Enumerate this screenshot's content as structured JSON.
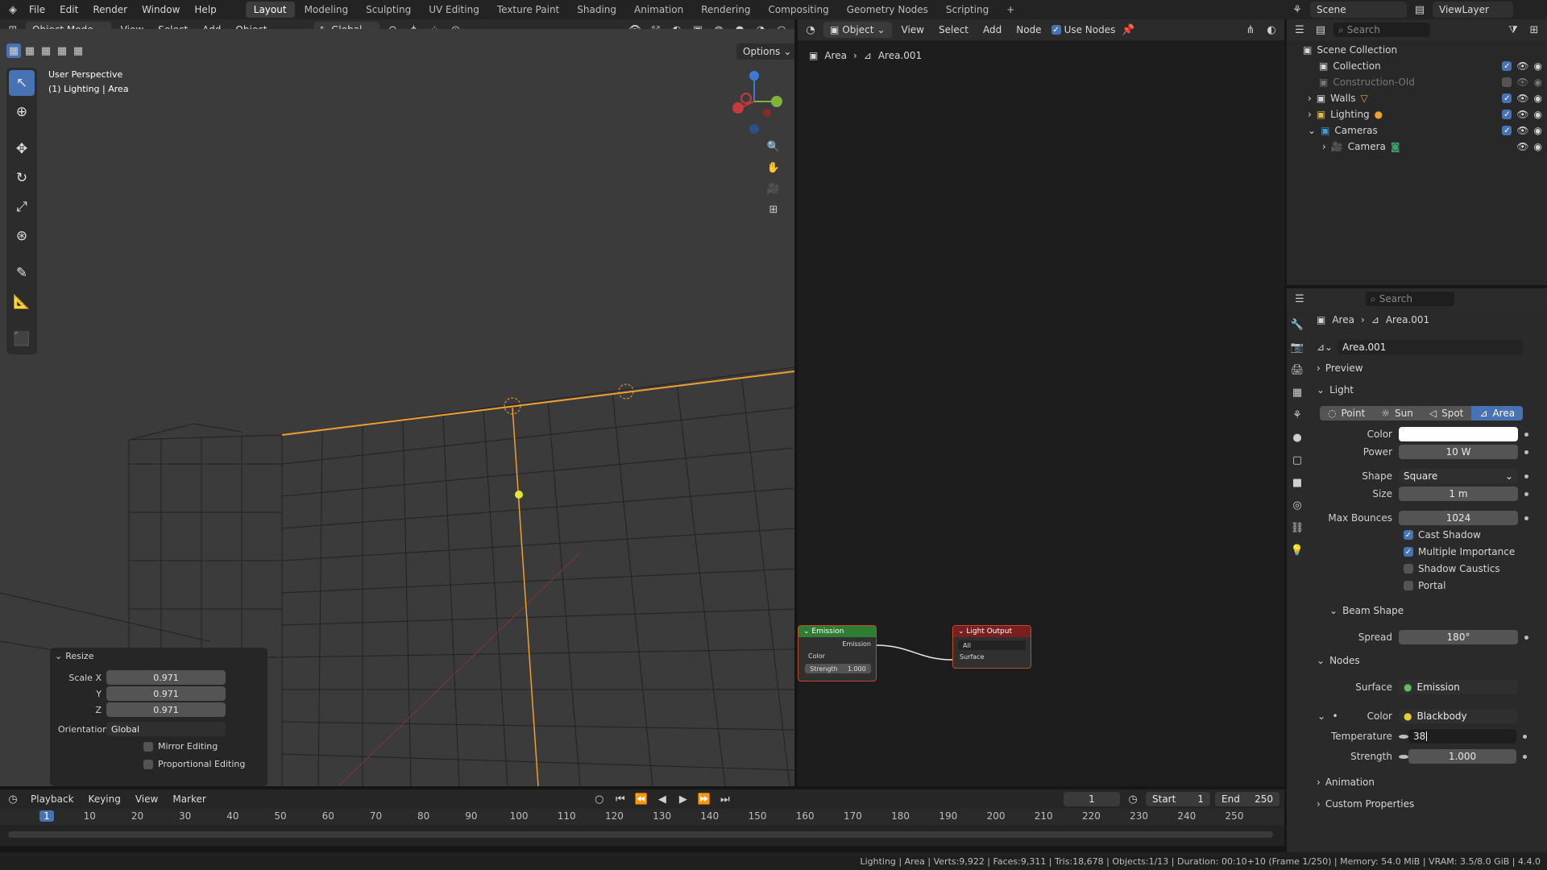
{
  "topbar": {
    "menus": [
      "File",
      "Edit",
      "Render",
      "Window",
      "Help"
    ],
    "workspaces": [
      "Layout",
      "Modeling",
      "Sculpting",
      "UV Editing",
      "Texture Paint",
      "Shading",
      "Animation",
      "Rendering",
      "Compositing",
      "Geometry Nodes",
      "Scripting"
    ],
    "active_workspace": "Layout",
    "add_tab": "+",
    "scene": "Scene",
    "view_layer": "ViewLayer"
  },
  "viewport": {
    "mode": "Object Mode",
    "menus": [
      "View",
      "Select",
      "Add",
      "Object"
    ],
    "orientation": "Global",
    "options": "Options",
    "overlay_title": "User Perspective",
    "overlay_sub": "(1) Lighting | Area"
  },
  "resize_panel": {
    "title": "Resize",
    "scale_x_label": "Scale X",
    "scale_x": "0.971",
    "y_label": "Y",
    "y": "0.971",
    "z_label": "Z",
    "z": "0.971",
    "orientation_label": "Orientation",
    "orientation": "Global",
    "mirror_editing": "Mirror Editing",
    "proportional_editing": "Proportional Editing"
  },
  "node_editor": {
    "type": "Object",
    "menus": [
      "View",
      "Select",
      "Add",
      "Node"
    ],
    "use_nodes": "Use Nodes",
    "breadcrumb_object": "Area",
    "breadcrumb_data": "Area.001",
    "emission_node": {
      "title": "Emission",
      "output": "Emission",
      "color": "Color",
      "strength_label": "Strength",
      "strength": "1.000"
    },
    "light_output_node": {
      "title": "Light Output",
      "target": "All",
      "surface": "Surface"
    }
  },
  "outliner": {
    "search_placeholder": "Search",
    "items": [
      {
        "label": "Scene Collection"
      },
      {
        "label": "Collection"
      },
      {
        "label": "Construction-Old"
      },
      {
        "label": "Walls"
      },
      {
        "label": "Lighting"
      },
      {
        "label": "Cameras"
      },
      {
        "label": "Camera"
      }
    ]
  },
  "properties": {
    "search_placeholder": "Search",
    "breadcrumb_object": "Area",
    "breadcrumb_data": "Area.001",
    "datablock": "Area.001",
    "preview": "Preview",
    "light": "Light",
    "light_types": [
      "Point",
      "Sun",
      "Spot",
      "Area"
    ],
    "active_light_type": "Area",
    "color_label": "Color",
    "color_value": "#ffffff",
    "power_label": "Power",
    "power": "10 W",
    "shape_label": "Shape",
    "shape": "Square",
    "size_label": "Size",
    "size": "1 m",
    "max_bounces_label": "Max Bounces",
    "max_bounces": "1024",
    "cast_shadow": "Cast Shadow",
    "multiple_importance": "Multiple Importance",
    "shadow_caustics": "Shadow Caustics",
    "portal": "Portal",
    "beam_shape": "Beam Shape",
    "spread_label": "Spread",
    "spread": "180°",
    "nodes": "Nodes",
    "surface_label": "Surface",
    "surface": "Emission",
    "node_color_label": "Color",
    "node_color": "Blackbody",
    "temperature_label": "Temperature",
    "temperature": "38",
    "strength_label": "Strength",
    "strength": "1.000",
    "animation": "Animation",
    "custom_properties": "Custom Properties"
  },
  "timeline": {
    "menus": [
      "Playback",
      "Keying",
      "View",
      "Marker"
    ],
    "current_frame": "1",
    "start_label": "Start",
    "start": "1",
    "end_label": "End",
    "end": "250",
    "ticks": [
      "1",
      "10",
      "20",
      "30",
      "40",
      "50",
      "60",
      "70",
      "80",
      "90",
      "100",
      "110",
      "120",
      "130",
      "140",
      "150",
      "160",
      "170",
      "180",
      "190",
      "200",
      "210",
      "220",
      "230",
      "240",
      "250"
    ]
  },
  "status": {
    "text": "Lighting | Area | Verts:9,922 | Faces:9,311 | Tris:18,678 | Objects:1/13 | Duration: 00:10+10 (Frame 1/250) | Memory: 54.0 MiB | VRAM: 3.5/8.0 GiB | 4.4.0"
  },
  "colors": {
    "accent": "#4772b3",
    "selection": "#f0a030",
    "emission_header": "#2e7d32",
    "output_header": "#7a1f1f"
  }
}
